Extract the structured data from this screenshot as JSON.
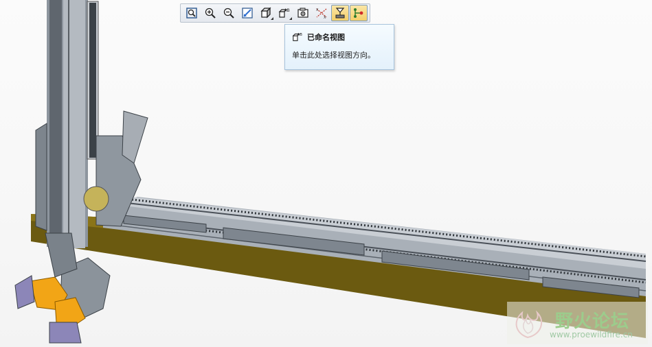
{
  "toolbar": {
    "buttons": [
      {
        "icon": "zoom-fit-icon"
      },
      {
        "icon": "zoom-in-icon"
      },
      {
        "icon": "zoom-out-icon"
      },
      {
        "icon": "repaint-icon"
      },
      {
        "icon": "display-style-icon"
      },
      {
        "icon": "named-views-icon"
      },
      {
        "icon": "view-manager-icon"
      },
      {
        "icon": "datum-display-icon"
      },
      {
        "icon": "annotation-display-icon"
      },
      {
        "icon": "spin-center-icon"
      }
    ],
    "active_buttons": [
      "annotation-display-icon",
      "spin-center-icon"
    ]
  },
  "tooltip": {
    "title": "已命名视图",
    "description": "单击此处选择视图方向。"
  },
  "watermark": {
    "name": "野火论坛",
    "url": "www.proewildfire.cn"
  },
  "colors": {
    "beam_gold": "#6b5a10",
    "rail_gray": "#9aa3ad",
    "orange_part": "#f2a516",
    "tooltip_bg": "#eaf4fc",
    "toolbar_active": "#f3cf6a"
  }
}
